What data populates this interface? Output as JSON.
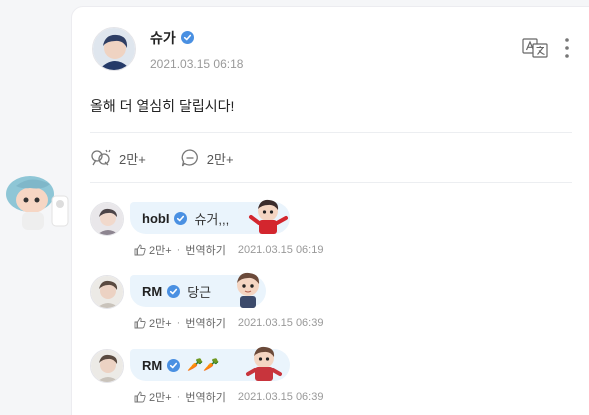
{
  "post": {
    "author": "슈가",
    "time": "2021.03.15 06:18",
    "text": "올해 더 열심히 달립시다!",
    "likes": "2만+",
    "comments_count": "2만+"
  },
  "comments": [
    {
      "author": "hobI",
      "text": "슈거,,,",
      "likes": "2만+",
      "translate_label": "번역하기",
      "time": "2021.03.15 06:19"
    },
    {
      "author": "RM",
      "text": "당근",
      "likes": "2만+",
      "translate_label": "번역하기",
      "time": "2021.03.15 06:39"
    },
    {
      "author": "RM",
      "text": "🥕🥕",
      "likes": "2만+",
      "translate_label": "번역하기",
      "time": "2021.03.15 06:39"
    }
  ],
  "colors": {
    "accent": "#4a90e2",
    "bubble": "#eaf4fc",
    "muted": "#999999"
  },
  "icons": [
    "mascot-sticker",
    "verified-icon",
    "translate-icon",
    "more-icon",
    "cheer-icon",
    "comment-icon",
    "like-icon",
    "character-sticker"
  ]
}
